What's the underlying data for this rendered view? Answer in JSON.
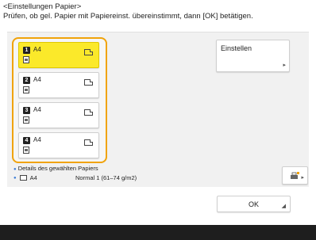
{
  "header": {
    "title": "<Einstellungen Papier>",
    "instruction": "Prüfen, ob gel. Papier mit Papiereinst. übereinstimmt, dann [OK] betätigen."
  },
  "trays": [
    {
      "number": "1",
      "size": "A4",
      "selected": true
    },
    {
      "number": "2",
      "size": "A4",
      "selected": false
    },
    {
      "number": "3",
      "size": "A4",
      "selected": false
    },
    {
      "number": "4",
      "size": "A4",
      "selected": false
    }
  ],
  "setup_button": {
    "label": "Einstellen"
  },
  "info": {
    "details_label": "Details des gewählten Papiers",
    "paper_size": "A4",
    "media_type": "Normal 1 (61–74 g/m2)"
  },
  "ok_button": {
    "label": "OK"
  },
  "icons": {
    "settings": "printer-settings-icon",
    "arrow": "button-arrow-icon"
  },
  "colors": {
    "selected_tray": "#fbe92a",
    "tray_group_border": "#f0a30a",
    "bullet": "#3a7bd5",
    "footer": "#1e1e1e"
  }
}
